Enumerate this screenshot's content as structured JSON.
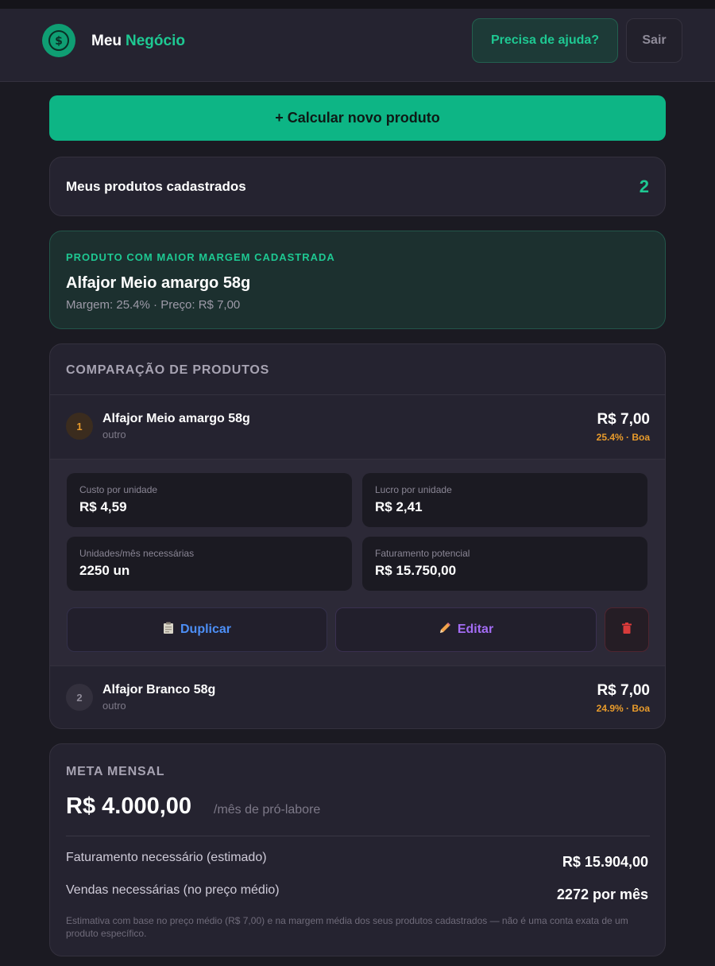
{
  "header": {
    "brand_primary": "Meu",
    "brand_accent": "Negócio",
    "help_label": "Precisa de ajuda?",
    "exit_label": "Sair",
    "logo_icon": "dollar-coin-icon"
  },
  "cta": {
    "label": "+ Calcular novo produto"
  },
  "registered": {
    "label": "Meus produtos cadastrados",
    "count": "2"
  },
  "best_product": {
    "kicker": "PRODUTO COM MAIOR MARGEM CADASTRADA",
    "name": "Alfajor Meio amargo 58g",
    "meta": "Margem: 25.4% · Preço: R$ 7,00"
  },
  "comparison": {
    "title": "COMPARAÇÃO DE PRODUTOS",
    "products": [
      {
        "rank": "1",
        "name": "Alfajor Meio amargo 58g",
        "category": "outro",
        "price": "R$ 7,00",
        "margin": "25.4% · Boa",
        "expanded": true,
        "stats": [
          {
            "label": "Custo por unidade",
            "value": "R$ 4,59"
          },
          {
            "label": "Lucro por unidade",
            "value": "R$ 2,41"
          },
          {
            "label": "Unidades/mês necessárias",
            "value": "2250 un"
          },
          {
            "label": "Faturamento potencial",
            "value": "R$ 15.750,00"
          }
        ],
        "actions": {
          "duplicate": "Duplicar",
          "edit": "Editar",
          "duplicate_icon": "clipboard-icon",
          "edit_icon": "pencil-icon",
          "delete_icon": "trash-icon"
        }
      },
      {
        "rank": "2",
        "name": "Alfajor Branco 58g",
        "category": "outro",
        "price": "R$ 7,00",
        "margin": "24.9% · Boa",
        "expanded": false
      }
    ]
  },
  "goal": {
    "title": "META MENSAL",
    "amount": "R$ 4.000,00",
    "unit": "/mês de pró-labore",
    "rows": [
      {
        "label": "Faturamento necessário (estimado)",
        "value": "R$ 15.904,00"
      },
      {
        "label": "Vendas necessárias (no preço médio)",
        "value": "2272 por mês"
      }
    ],
    "note": "Estimativa com base no preço médio (R$ 7,00) e na margem média dos seus produtos cadastrados — não é uma conta exata de um produto específico."
  },
  "colors": {
    "accent": "#1ec892",
    "cta": "#0db585",
    "warning": "#e89b2b",
    "duplicate": "#4d8ff7",
    "edit": "#a36cf4",
    "delete": "#d83b3b"
  }
}
